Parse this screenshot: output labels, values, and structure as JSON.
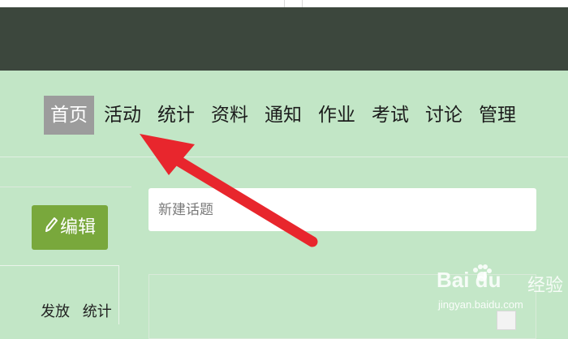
{
  "nav": {
    "items": [
      {
        "label": "首页",
        "active": true
      },
      {
        "label": "活动",
        "active": false
      },
      {
        "label": "统计",
        "active": false
      },
      {
        "label": "资料",
        "active": false
      },
      {
        "label": "通知",
        "active": false
      },
      {
        "label": "作业",
        "active": false
      },
      {
        "label": "考试",
        "active": false
      },
      {
        "label": "讨论",
        "active": false
      },
      {
        "label": "管理",
        "active": false
      }
    ]
  },
  "sidebar": {
    "edit_button_label": "编辑",
    "edit_icon": "pencil-icon",
    "links": [
      "发放",
      "统计"
    ]
  },
  "topic": {
    "placeholder": "新建话题"
  },
  "annotation": {
    "arrow_color": "#e8262d",
    "icon": "red-arrow"
  },
  "watermark": {
    "logo_text": "Bai du",
    "sub_text": "经验",
    "url": "jingyan.baidu.com"
  },
  "colors": {
    "header": "#3c473d",
    "page_bg": "#c2e6c6",
    "active_tab": "#9c9c9c",
    "edit_button": "#79a83c"
  }
}
